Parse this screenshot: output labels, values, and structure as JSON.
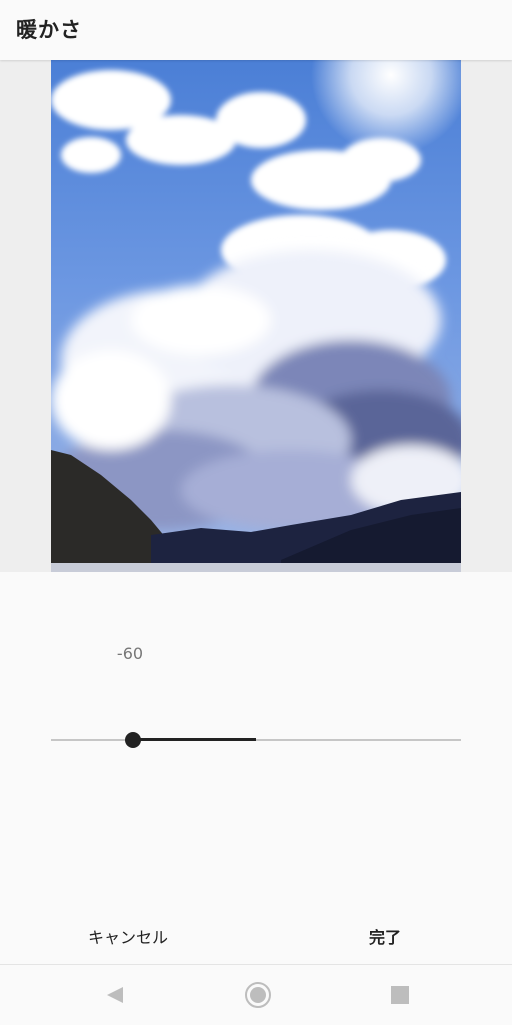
{
  "header": {
    "title": "暖かさ"
  },
  "adjustment": {
    "value_text": "-60",
    "value": -60,
    "min": -100,
    "max": 100
  },
  "actions": {
    "cancel_label": "キャンセル",
    "done_label": "完了"
  },
  "navbar": {
    "back_icon": "triangle-back-icon",
    "home_icon": "circle-home-icon",
    "recents_icon": "square-recents-icon"
  },
  "colors": {
    "accent": "#222222",
    "track": "#c6c6c6"
  }
}
